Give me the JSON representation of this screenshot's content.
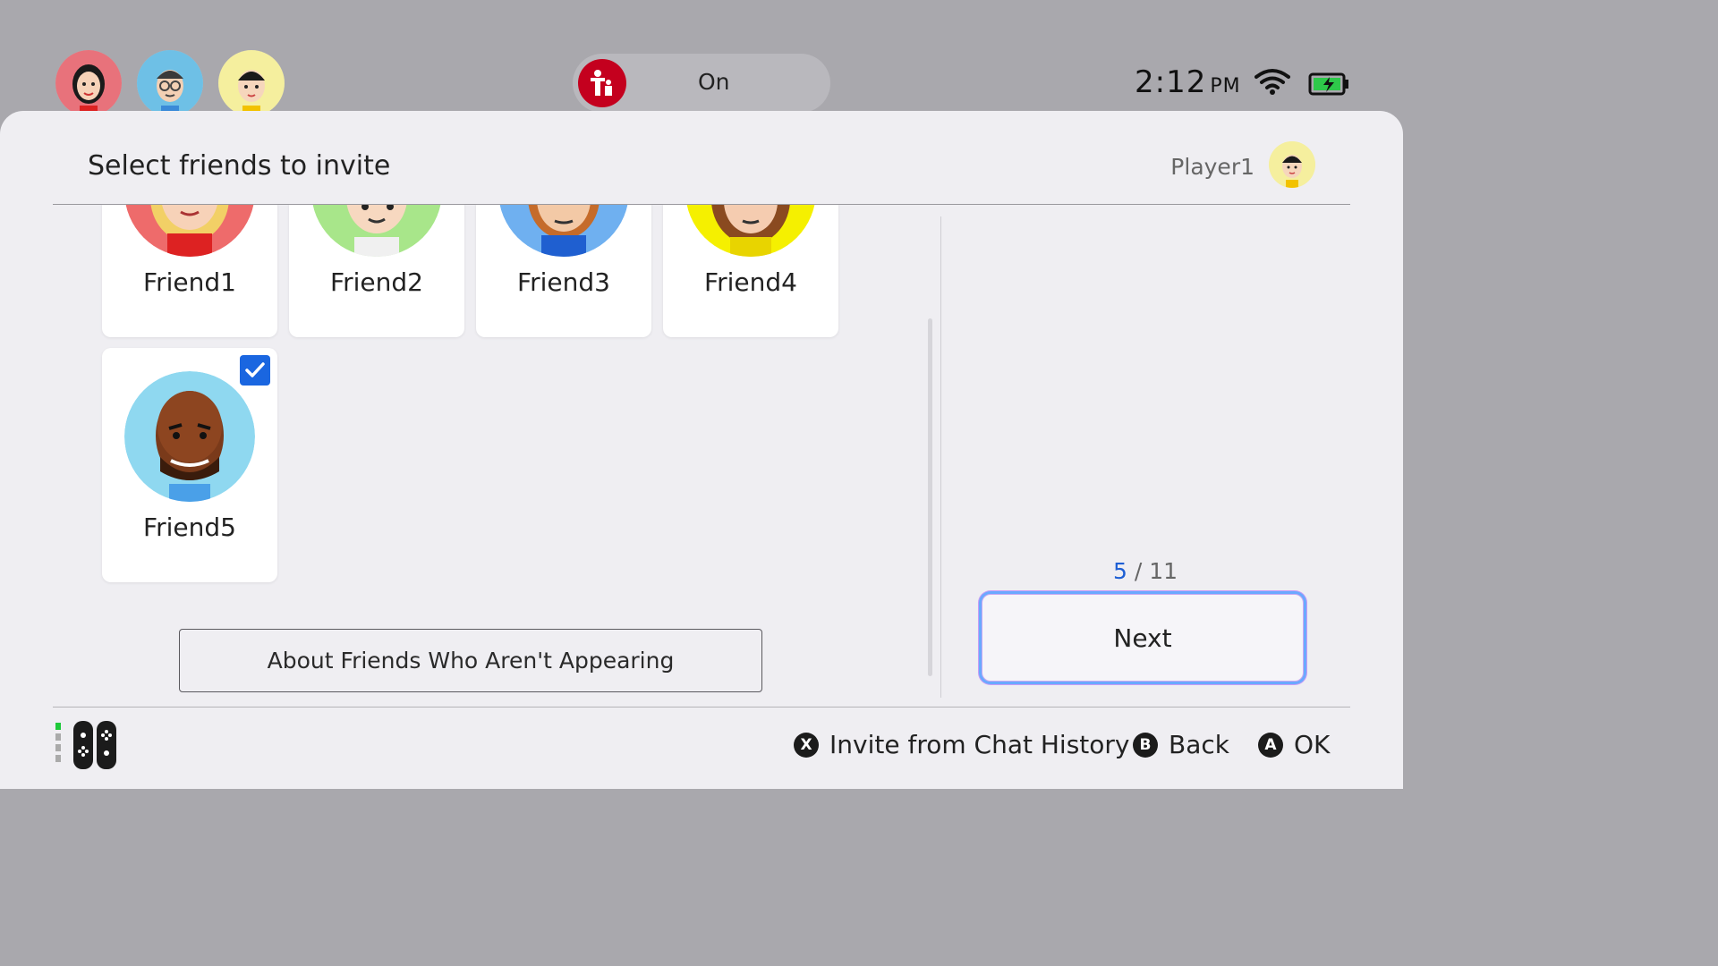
{
  "top_bar": {
    "users": [
      {
        "name": "user-avatar-1",
        "bg": "#e8727b"
      },
      {
        "name": "user-avatar-2",
        "bg": "#6ec0e6"
      },
      {
        "name": "user-avatar-3",
        "bg": "#f5ef9e"
      }
    ],
    "parental_controls": {
      "icon": "parental-controls-icon",
      "label": "On"
    },
    "clock": {
      "time": "2:12",
      "ampm": "PM"
    },
    "wifi_icon": "wifi-icon",
    "battery_icon": "battery-charging-icon"
  },
  "header": {
    "title": "Select friends to invite",
    "player_name": "Player1"
  },
  "friends": [
    {
      "name": "Friend1",
      "bg": "#ee6b6b",
      "selected": false
    },
    {
      "name": "Friend2",
      "bg": "#a8e68a",
      "selected": false
    },
    {
      "name": "Friend3",
      "bg": "#6fb0f0",
      "selected": false
    },
    {
      "name": "Friend4",
      "bg": "#f5f000",
      "selected": false
    },
    {
      "name": "Friend5",
      "bg": "#8fd8f0",
      "selected": true
    }
  ],
  "about_button": "About Friends Who Aren't Appearing",
  "selection": {
    "current": "5",
    "separator": "/",
    "max": "11"
  },
  "next_button": "Next",
  "footer": {
    "hints": [
      {
        "glyph": "X",
        "label": "Invite from Chat History"
      },
      {
        "glyph": "B",
        "label": "Back"
      },
      {
        "glyph": "A",
        "label": "OK"
      }
    ]
  },
  "colors": {
    "accent": "#1e5fd4",
    "checkbox": "#1a66e0",
    "panel": "#efeef2"
  }
}
